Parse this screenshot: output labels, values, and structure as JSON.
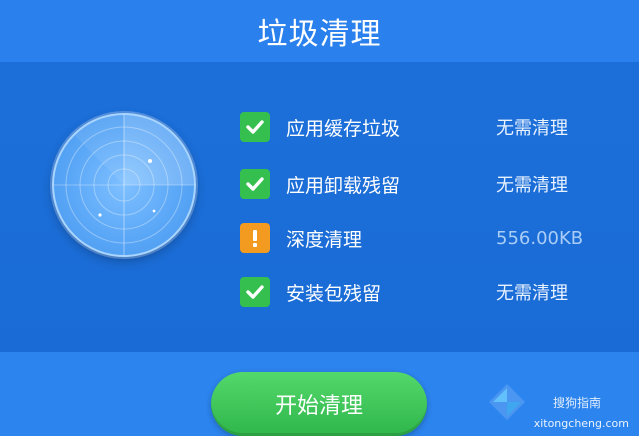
{
  "header": {
    "title": "垃圾清理"
  },
  "items": [
    {
      "label": "应用缓存垃圾",
      "status": "无需清理",
      "state": "ok"
    },
    {
      "label": "应用卸载残留",
      "status": "无需清理",
      "state": "ok"
    },
    {
      "label": "深度清理",
      "status": "556.00KB",
      "state": "warn"
    },
    {
      "label": "安装包残留",
      "status": "无需清理",
      "state": "ok"
    }
  ],
  "footer": {
    "start_label": "开始清理"
  },
  "watermark": {
    "brand": "搜狗指南",
    "domain": "xitongcheng.com"
  },
  "colors": {
    "background": "#1a73e0",
    "header": "#2a80ec",
    "ok": "#34bf4f",
    "warn": "#f39a21",
    "button": "#3fc85a"
  }
}
